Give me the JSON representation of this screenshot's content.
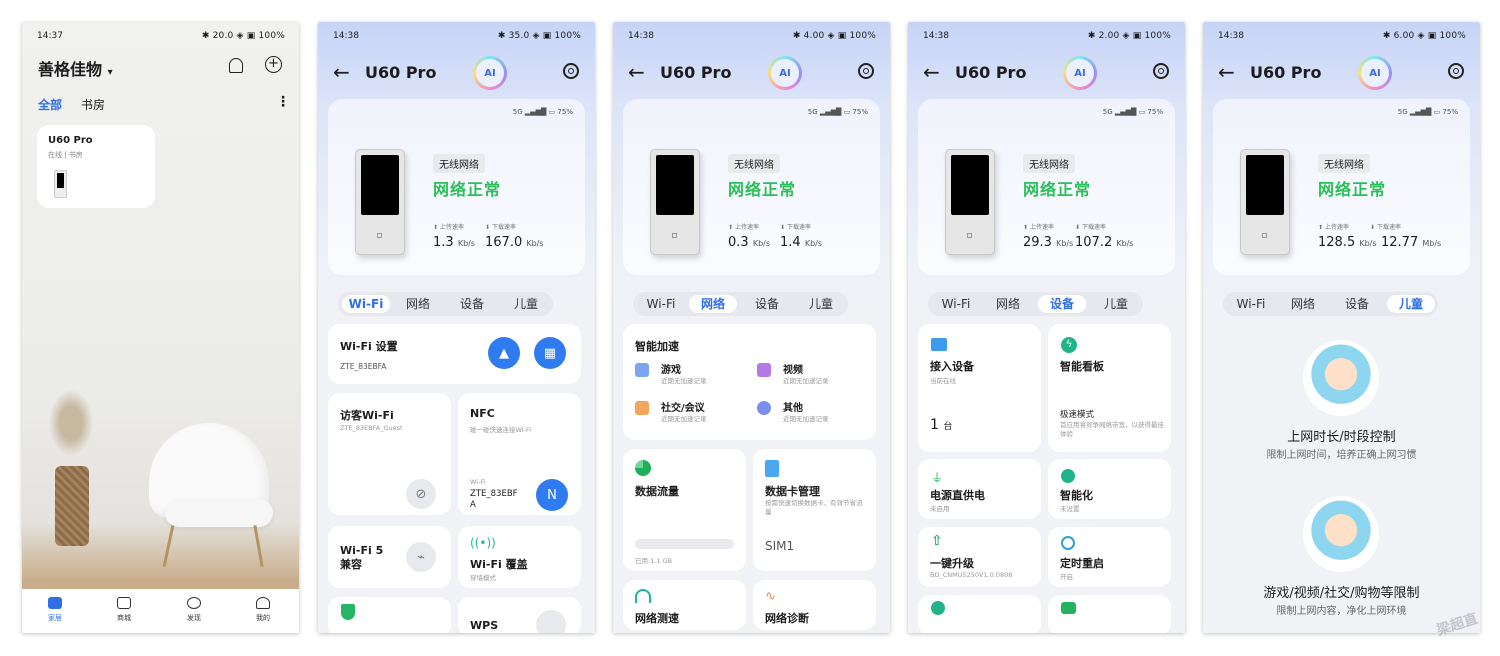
{
  "status": [
    {
      "time": "14:37",
      "right": "✱ 20.0 ◈ ▣ 100%"
    },
    {
      "time": "14:38",
      "right": "✱ 35.0 ◈ ▣ 100%"
    },
    {
      "time": "14:38",
      "right": "✱ 4.00 ◈ ▣ 100%"
    },
    {
      "time": "14:38",
      "right": "✱ 2.00 ◈ ▣ 100%"
    },
    {
      "time": "14:38",
      "right": "✱ 6.00 ◈ ▣ 100%"
    }
  ],
  "home": {
    "title": "善格佳物",
    "title_caret": "▾",
    "tab_all": "全部",
    "tab_study": "书房",
    "more": "⋮",
    "device_card": {
      "name": "U60 Pro",
      "status": "在线 | 书房"
    },
    "nav": [
      {
        "label": "家居"
      },
      {
        "label": "商城"
      },
      {
        "label": "发现"
      },
      {
        "label": "我的"
      }
    ]
  },
  "device": {
    "back": "←",
    "title": "U60 Pro",
    "ai": "AI",
    "signal": "5G ▂▄▆█ ▭ 75%",
    "type_tag": "无线网络",
    "net_status": "网络正常",
    "up_label": "上传速率",
    "down_label": "下载速率",
    "speeds": [
      {
        "up": "1.3",
        "up_unit": "Kb/s",
        "down": "167.0",
        "down_unit": "Kb/s"
      },
      {
        "up": "0.3",
        "up_unit": "Kb/s",
        "down": "1.4",
        "down_unit": "Kb/s"
      },
      {
        "up": "29.3",
        "up_unit": "Kb/s",
        "down": "107.2",
        "down_unit": "Kb/s"
      },
      {
        "up": "128.5",
        "up_unit": "Kb/s",
        "down": "12.77",
        "down_unit": "Mb/s"
      }
    ]
  },
  "tabs": [
    "Wi-Fi",
    "网络",
    "设备",
    "儿童"
  ],
  "wifi": {
    "settings": "Wi-Fi 设置",
    "ssid": "ZTE_83EBFA",
    "guest": "访客Wi-Fi",
    "guest_ssid": "ZTE_83EBFA_Guest",
    "nfc": "NFC",
    "nfc_desc": "碰一碰快速连接Wi-Fi",
    "nfc_wifi": "Wi-Fi",
    "nfc_ssid": "ZTE_83EBF A",
    "wifi5": "Wi-Fi 5 兼容",
    "coverage": "Wi-Fi 覆盖",
    "coverage_desc": "穿墙模式",
    "wps": "WPS"
  },
  "network": {
    "accel": "智能加速",
    "items": [
      {
        "name": "游戏",
        "desc": "近期无加速记录"
      },
      {
        "name": "视频",
        "desc": "近期无加速记录"
      },
      {
        "name": "社交/会议",
        "desc": "近期无加速记录"
      },
      {
        "name": "其他",
        "desc": "近期无加速记录"
      }
    ],
    "traffic": "数据流量",
    "used": "已用:1.1 GB",
    "simmgr": "数据卡管理",
    "simmgr_desc": "按需快速切换数据卡，有效节省流量",
    "sim": "SIM1",
    "speedtest": "网络测速",
    "diag": "网络诊断"
  },
  "devices": {
    "connected": "接入设备",
    "connected_sub": "当前在线",
    "count": "1",
    "count_unit": "台",
    "board": "智能看板",
    "board_mode": "极速模式",
    "board_desc": "首应用将竞争网络带宽，以获得最佳体验",
    "power": "电源直供电",
    "power_sub": "未启用",
    "smart": "智能化",
    "smart_sub": "未设置",
    "upgrade": "一键升级",
    "upgrade_sub": "BD_CNMU5250V1.0.0808",
    "reboot": "定时重启",
    "reboot_sub": "开启"
  },
  "kids": {
    "t1": "上网时长/时段控制",
    "s1": "限制上网时间，培养正确上网习惯",
    "t2": "游戏/视频/社交/购物等限制",
    "s2": "限制上网内容，净化上网环境"
  },
  "watermark": "梁超直",
  "colors": {
    "accent": "#2f6fe6",
    "ok": "#2bbf5a"
  }
}
